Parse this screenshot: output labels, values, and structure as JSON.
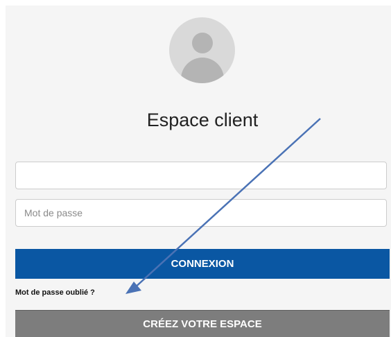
{
  "header": {
    "title": "Espace client"
  },
  "login_form": {
    "username_value": "",
    "username_placeholder": "",
    "password_placeholder": "Mot de passe",
    "login_button_label": "CONNEXION",
    "forgot_password_label": "Mot de passe oublié ?",
    "create_account_label": "CRÉEZ VOTRE ESPACE"
  },
  "colors": {
    "primary_button": "#0a57a3",
    "secondary_button": "#7d7d7d",
    "annotation_arrow": "#4a72b5"
  },
  "annotation": {
    "type": "arrow",
    "points_to": "forgot-password-link"
  }
}
